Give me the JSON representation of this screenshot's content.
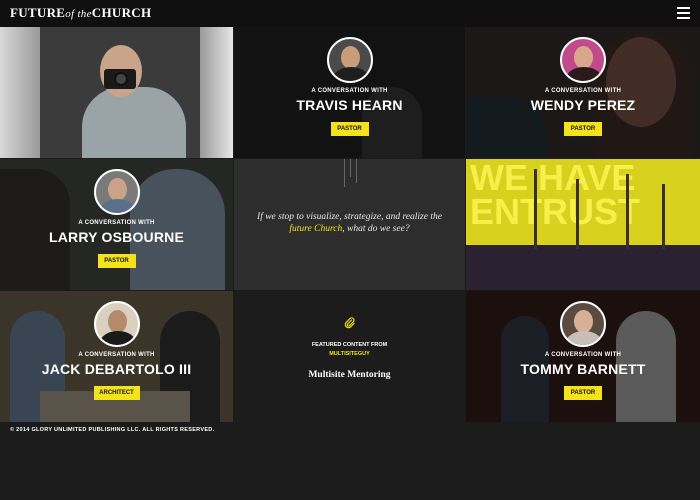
{
  "header": {
    "logo_prefix": "FUTURE",
    "logo_mid": "of the",
    "logo_suffix": "CHURCH"
  },
  "tiles": {
    "travis": {
      "intro": "A conversation with",
      "name": "Travis Hearn",
      "role": "Pastor"
    },
    "wendy": {
      "intro": "A conversation with",
      "name": "Wendy Perez",
      "role": "Pastor"
    },
    "larry": {
      "intro": "A conversation with",
      "name": "Larry Osbourne",
      "role": "Pastor"
    },
    "jack": {
      "intro": "A conversation with",
      "name": "Jack Debartolo III",
      "role": "Architect"
    },
    "tommy": {
      "intro": "A conversation with",
      "name": "Tommy Barnett",
      "role": "Pastor"
    },
    "quote": {
      "before": "If we stop to visualize, strategize, and realize the ",
      "highlight": "future Church",
      "after": ", what do we see?"
    },
    "featured": {
      "label": "Featured content from",
      "author": "Multisiteguy",
      "title": "Multisite Mentoring"
    },
    "banner_text": "WE HAVE ENTRUST"
  },
  "footer": {
    "text": "© 2014 Glory Unlimited Publishing LLC. All rights reserved."
  },
  "colors": {
    "accent": "#f4e21a",
    "background": "#1b1b1b",
    "topbar": "#0f0f0f"
  },
  "icons": {
    "menu": "hamburger-icon",
    "featured": "paperclip-icon"
  }
}
